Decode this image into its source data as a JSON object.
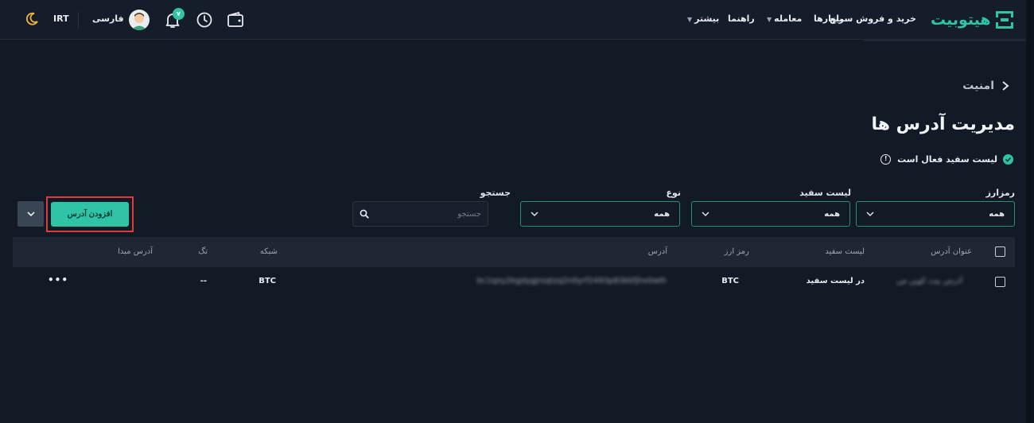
{
  "header": {
    "logo_text": "هیتوبیت",
    "nav": {
      "quick_trade": "خرید و فروش سریع",
      "markets": "بازارها",
      "trade": "معامله",
      "guide": "راهنما",
      "more": "بیشتر"
    },
    "notification_count": "۷",
    "language": "فارسی",
    "currency": "IRT"
  },
  "breadcrumb": {
    "label": "امنیت"
  },
  "page_title": "مدیریت آدرس ها",
  "whitelist_status": "لیست سفید فعال است",
  "filters": {
    "currency": {
      "label": "رمزارز",
      "value": "همه"
    },
    "whitelist": {
      "label": "لیست سفید",
      "value": "همه"
    },
    "type": {
      "label": "نوع",
      "value": "همه"
    },
    "search": {
      "label": "جستجو",
      "placeholder": "جستجو"
    }
  },
  "actions": {
    "add_address": "افزودن آدرس"
  },
  "table": {
    "columns": {
      "title": "عنوان آدرس",
      "whitelist": "لیست سفید",
      "currency": "رمز ارز",
      "address": "آدرس",
      "network": "شبکه",
      "tag": "تگ",
      "source": "آدرس مبدا"
    },
    "rows": [
      {
        "title": "آدرس بیت کوین من",
        "whitelist": "در لیست سفید",
        "currency": "BTC",
        "address": "bc1qxy2kgdygjrsqtzq2n0yrf2493p83kkfjhx0wlh",
        "network": "BTC",
        "tag": "--",
        "source": "",
        "menu": "•••"
      }
    ]
  },
  "colors": {
    "accent": "#2ec4a5",
    "background": "#121a25",
    "highlight_border": "#e0393e"
  }
}
